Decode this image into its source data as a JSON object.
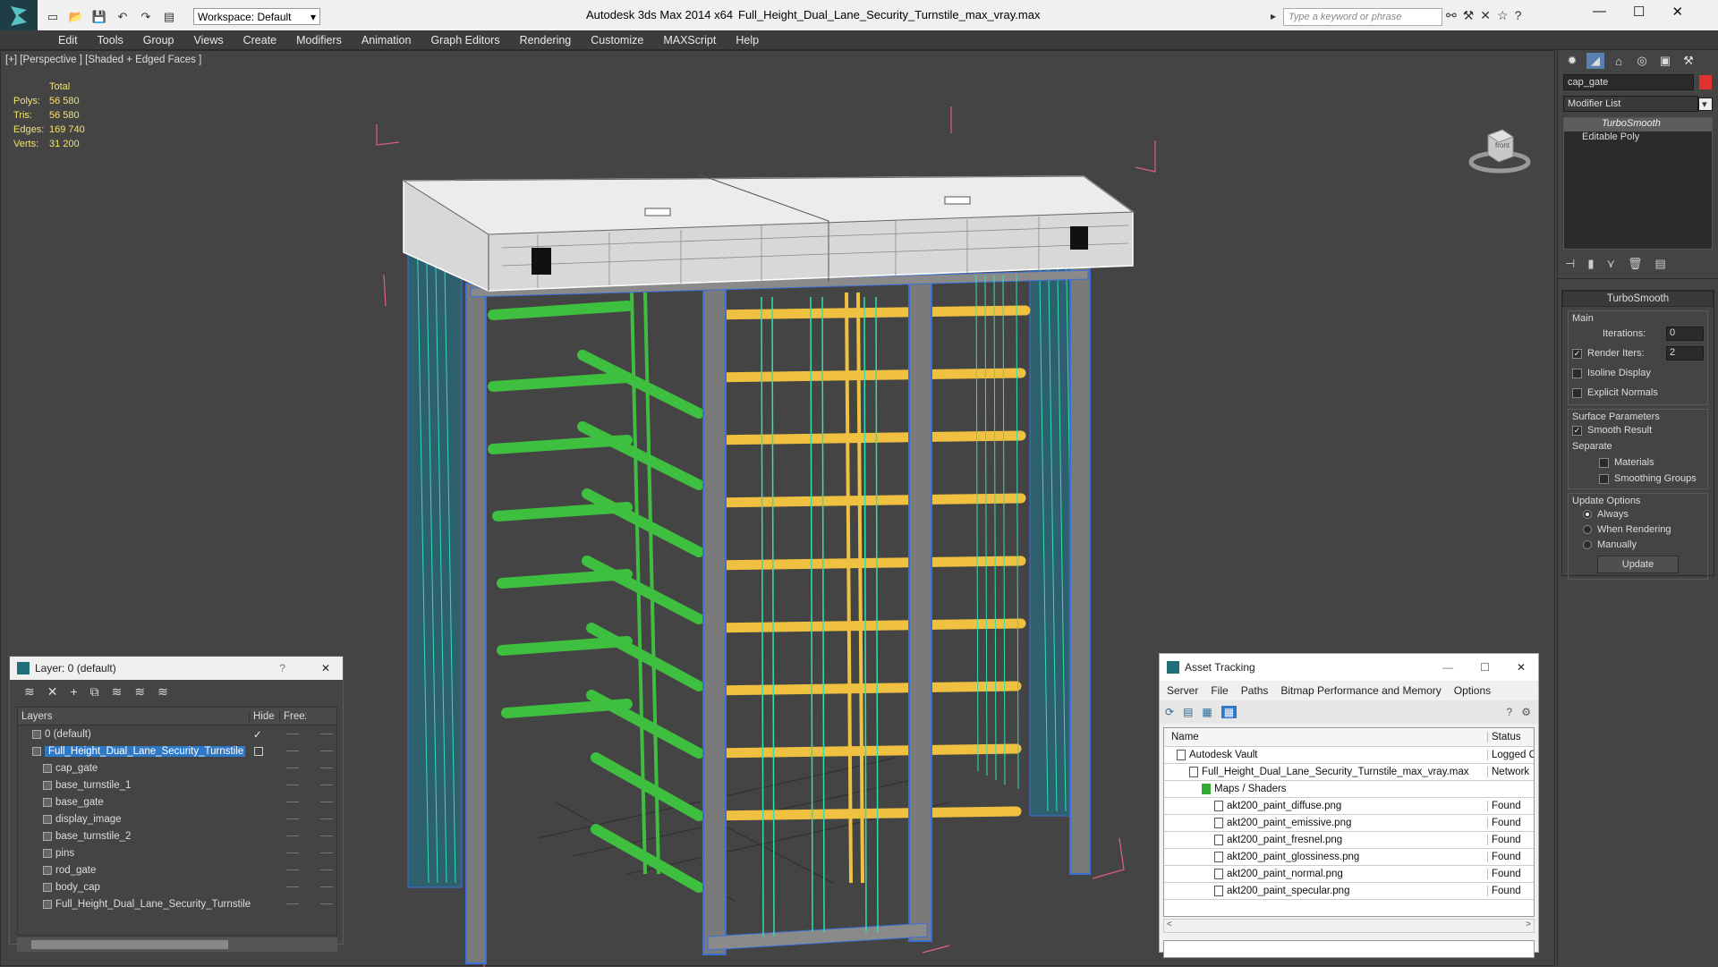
{
  "titlebar": {
    "workspace": "Workspace: Default",
    "app_title": "Autodesk 3ds Max  2014 x64",
    "file_title": "Full_Height_Dual_Lane_Security_Turnstile_max_vray.max",
    "search_placeholder": "Type a keyword or phrase"
  },
  "menu": [
    "Edit",
    "Tools",
    "Group",
    "Views",
    "Create",
    "Modifiers",
    "Animation",
    "Graph Editors",
    "Rendering",
    "Customize",
    "MAXScript",
    "Help"
  ],
  "viewport": {
    "label": "[+] [Perspective ] [Shaded + Edged Faces ]",
    "stats": {
      "header": "Total",
      "rows": [
        {
          "label": "Polys:",
          "value": "56 580"
        },
        {
          "label": "Tris:",
          "value": "56 580"
        },
        {
          "label": "Edges:",
          "value": "169 740"
        },
        {
          "label": "Verts:",
          "value": "31 200"
        }
      ]
    },
    "viewcube_label": "front",
    "colors": {
      "bg": "#444444",
      "frame": "#ffffff",
      "bars_green": "#3fbf3f",
      "bars_yellow": "#f0c040",
      "post_blue": "#3a6fd8",
      "bbox": "#e06080"
    }
  },
  "command_panel": {
    "object_name": "cap_gate",
    "modifier_list": "Modifier List",
    "stack": [
      "TurboSmooth",
      "Editable Poly"
    ],
    "rollout_title": "TurboSmooth",
    "main_group": "Main",
    "iterations_label": "Iterations:",
    "iterations_value": "0",
    "render_iters_label": "Render Iters:",
    "render_iters_value": "2",
    "isoline": "Isoline Display",
    "explicit_normals": "Explicit Normals",
    "surface_group": "Surface Parameters",
    "smooth_result": "Smooth Result",
    "separate": "Separate",
    "materials": "Materials",
    "smoothing_groups": "Smoothing Groups",
    "update_group": "Update Options",
    "always": "Always",
    "when_rendering": "When Rendering",
    "manually": "Manually",
    "update_button": "Update"
  },
  "layer_window": {
    "title": "Layer: 0 (default)",
    "col_layers": "Layers",
    "col_hide": "Hide",
    "col_freeze": "Freeze",
    "rows": [
      {
        "name": "0 (default)",
        "level": 0,
        "checked": true,
        "selected": false
      },
      {
        "name": "Full_Height_Dual_Lane_Security_Turnstile",
        "level": 0,
        "checked": false,
        "selected": true
      },
      {
        "name": "cap_gate",
        "level": 1
      },
      {
        "name": "base_turnstile_1",
        "level": 1
      },
      {
        "name": "base_gate",
        "level": 1
      },
      {
        "name": "display_image",
        "level": 1
      },
      {
        "name": "base_turnstile_2",
        "level": 1
      },
      {
        "name": "pins",
        "level": 1
      },
      {
        "name": "rod_gate",
        "level": 1
      },
      {
        "name": "body_cap",
        "level": 1
      },
      {
        "name": "Full_Height_Dual_Lane_Security_Turnstile",
        "level": 1
      }
    ]
  },
  "asset_window": {
    "title": "Asset Tracking",
    "menu": [
      "Server",
      "File",
      "Paths",
      "Bitmap Performance and Memory",
      "Options"
    ],
    "col_name": "Name",
    "col_status": "Status",
    "rows": [
      {
        "name": "Autodesk Vault",
        "status": "Logged O",
        "indent": 1
      },
      {
        "name": "Full_Height_Dual_Lane_Security_Turnstile_max_vray.max",
        "status": "Network",
        "indent": 2
      },
      {
        "name": "Maps / Shaders",
        "status": "",
        "indent": 3
      },
      {
        "name": "akt200_paint_diffuse.png",
        "status": "Found",
        "indent": 4
      },
      {
        "name": "akt200_paint_emissive.png",
        "status": "Found",
        "indent": 4
      },
      {
        "name": "akt200_paint_fresnel.png",
        "status": "Found",
        "indent": 4
      },
      {
        "name": "akt200_paint_glossiness.png",
        "status": "Found",
        "indent": 4
      },
      {
        "name": "akt200_paint_normal.png",
        "status": "Found",
        "indent": 4
      },
      {
        "name": "akt200_paint_specular.png",
        "status": "Found",
        "indent": 4
      }
    ]
  }
}
